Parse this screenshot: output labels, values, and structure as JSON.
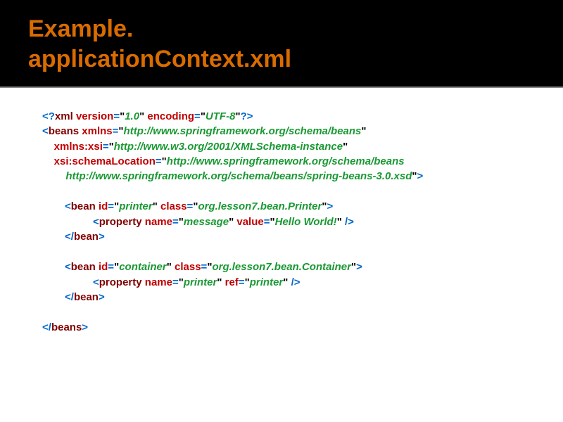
{
  "title_line1": "Example.",
  "title_line2": "applicationContext.xml",
  "xml": {
    "decl": {
      "version_attr": "version",
      "version_val": "1.0",
      "encoding_attr": "encoding",
      "encoding_val": "UTF-8"
    },
    "beans_open": {
      "tag": "beans",
      "xmlns_attr": "xmlns",
      "xmlns_val": "http://www.springframework.org/schema/beans",
      "xsi_attr": "xmlns:xsi",
      "xsi_val": "http://www.w3.org/2001/XMLSchema-instance",
      "loc_attr": "xsi:schemaLocation",
      "loc_val1": "http://www.springframework.org/schema/beans",
      "loc_val2": "http://www.springframework.org/schema/beans/spring-beans-3.0.xsd"
    },
    "bean1": {
      "tag": "bean",
      "id_attr": "id",
      "id_val": "printer",
      "class_attr": "class",
      "class_val": "org.lesson7.bean.Printer",
      "prop_tag": "property",
      "name_attr": "name",
      "name_val": "message",
      "value_attr": "value",
      "value_val": "Hello World!"
    },
    "bean2": {
      "tag": "bean",
      "id_attr": "id",
      "id_val": "container",
      "class_attr": "class",
      "class_val": "org.lesson7.bean.Container",
      "prop_tag": "property",
      "name_attr": "name",
      "name_val": "printer",
      "ref_attr": "ref",
      "ref_val": "printer"
    },
    "beans_close": "beans"
  }
}
